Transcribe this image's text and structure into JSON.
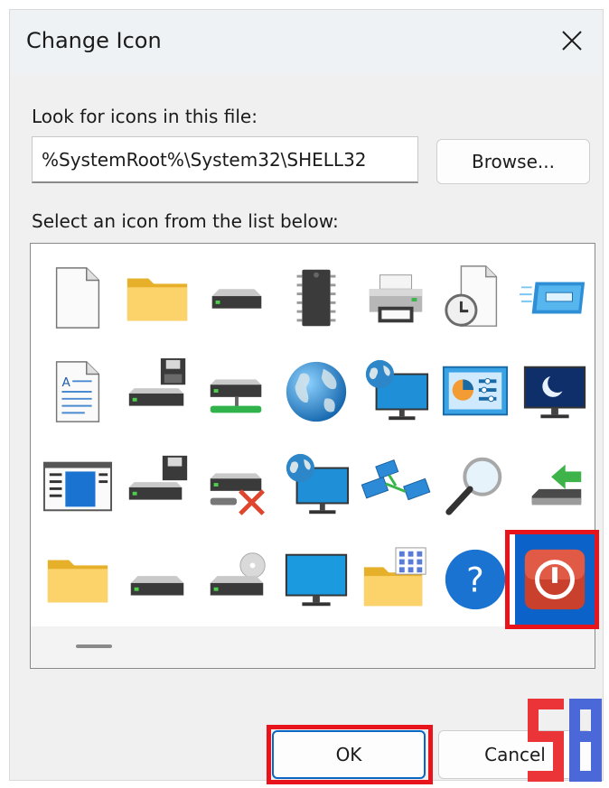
{
  "dialog": {
    "title": "Change Icon",
    "close_icon": "close-icon"
  },
  "file": {
    "label": "Look for icons in this file:",
    "path_value": "%SystemRoot%\\System32\\SHELL32",
    "browse_label": "Browse..."
  },
  "list": {
    "label": "Select an icon from the list below:",
    "icons": [
      "blank-document-icon",
      "folder-icon",
      "drive-icon",
      "chip-icon",
      "printer-icon",
      "document-clock-icon",
      "dvd-drive-icon",
      "text-document-icon",
      "floppy-drive-icon",
      "network-drive-icon",
      "globe-icon",
      "monitor-globe-icon",
      "control-panel-icon",
      "monitor-moon-icon",
      "window-icon",
      "drive-floppy-icon",
      "drive-disconnected-icon",
      "monitor-globe-icon",
      "network-icon",
      "magnifier-icon",
      "usb-drive-arrow-icon",
      "folder-icon",
      "drive-icon",
      "drive-cd-icon",
      "monitor-icon",
      "folder-grid-icon",
      "help-icon",
      "power-icon"
    ],
    "selected_index": 27
  },
  "actions": {
    "ok_label": "OK",
    "cancel_label": "Cancel"
  },
  "colors": {
    "accent": "#0b63c9",
    "highlight": "#e8141c",
    "logo_red": "#ea3438",
    "logo_blue": "#4a68d8"
  }
}
